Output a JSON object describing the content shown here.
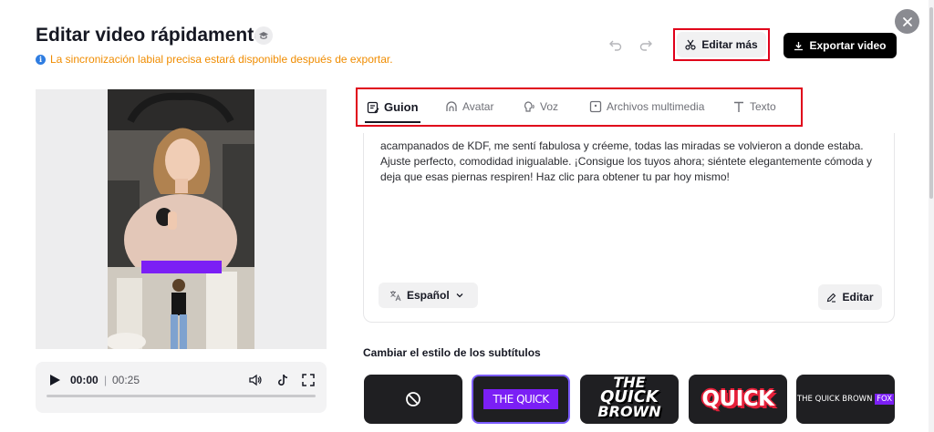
{
  "dialog": {
    "title": "Editar video rápidamente",
    "notice": "La sincronización labial precisa estará disponible después de exportar.",
    "close_icon": "close-icon"
  },
  "toolbar": {
    "edit_more_label": "Editar más",
    "export_label": "Exportar video"
  },
  "player": {
    "current_time": "00:00",
    "separator": "|",
    "duration": "00:25",
    "progress": 0
  },
  "tabs": [
    {
      "label": "Guion",
      "icon": "script-icon",
      "active": true
    },
    {
      "label": "Avatar",
      "icon": "avatar-icon",
      "active": false
    },
    {
      "label": "Voz",
      "icon": "voice-icon",
      "active": false
    },
    {
      "label": "Archivos multimedia",
      "icon": "media-icon",
      "active": false
    },
    {
      "label": "Texto",
      "icon": "text-icon",
      "active": false
    }
  ],
  "script": {
    "text": "acampanados de KDF, me sentí fabulosa y créeme, todas las miradas se volvieron a donde estaba. Ajuste perfecto, comodidad inigualable. ¡Consigue los tuyos ahora; siéntete elegantemente cómoda y deja que esas piernas respiren! Haz clic para obtener tu par hoy mismo!",
    "language": "Español",
    "edit_label": "Editar"
  },
  "subtitles": {
    "section_title": "Cambiar el estilo de los subtítulos",
    "styles": [
      {
        "name": "none",
        "text": ""
      },
      {
        "name": "purple-box",
        "text": "THE QUICK",
        "selected": true
      },
      {
        "name": "stacked",
        "lines": [
          "THE",
          "QUICK",
          "BROWN"
        ]
      },
      {
        "name": "red-outline",
        "text": "QUICK"
      },
      {
        "name": "highlight-word",
        "text": "THE QUICK BROWN",
        "highlight": "FOX"
      }
    ]
  },
  "colors": {
    "accent": "#7b1ff5",
    "notice": "#f08c00",
    "highlight_box": "#e0001a"
  }
}
